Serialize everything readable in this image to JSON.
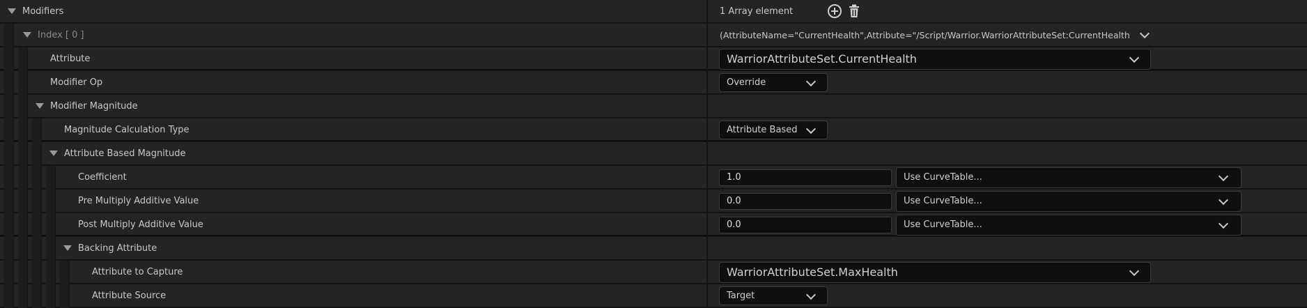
{
  "modifiers": {
    "label": "Modifiers",
    "count_text": "1 Array element"
  },
  "index_row": {
    "label": "Index [ 0 ]",
    "value": "(AttributeName=\"CurrentHealth\",Attribute=\"/Script/Warrior.WarriorAttributeSet:CurrentHealth\",Attribu"
  },
  "attribute": {
    "label": "Attribute",
    "value": "WarriorAttributeSet.CurrentHealth"
  },
  "modifier_op": {
    "label": "Modifier Op",
    "value": "Override"
  },
  "modifier_magnitude": {
    "label": "Modifier Magnitude"
  },
  "magnitude_calc_type": {
    "label": "Magnitude Calculation Type",
    "value": "Attribute Based"
  },
  "attribute_based_magnitude": {
    "label": "Attribute Based Magnitude"
  },
  "coefficient": {
    "label": "Coefficient",
    "value": "1.0",
    "curve": "Use CurveTable..."
  },
  "pre_multiply": {
    "label": "Pre Multiply Additive Value",
    "value": "0.0",
    "curve": "Use CurveTable..."
  },
  "post_multiply": {
    "label": "Post Multiply Additive Value",
    "value": "0.0",
    "curve": "Use CurveTable..."
  },
  "backing_attribute": {
    "label": "Backing Attribute"
  },
  "attribute_to_capture": {
    "label": "Attribute to Capture",
    "value": "WarriorAttributeSet.MaxHealth"
  },
  "attribute_source": {
    "label": "Attribute Source",
    "value": "Target"
  },
  "icons": [
    "add-element-icon",
    "delete-icon",
    "expand-triangle-icon",
    "chevron-down-icon"
  ]
}
